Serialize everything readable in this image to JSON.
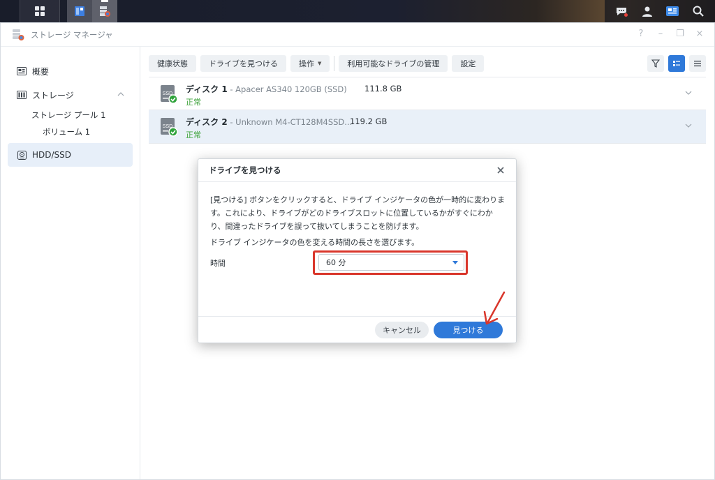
{
  "window": {
    "title": "ストレージ マネージャ",
    "controls": [
      "?",
      "–",
      "❐",
      "×"
    ]
  },
  "sidebar": {
    "items": [
      {
        "label": "概要",
        "icon": "overview-icon"
      },
      {
        "label": "ストレージ",
        "icon": "storage-icon"
      },
      {
        "label": "ストレージ プール 1"
      },
      {
        "label": "ボリューム 1"
      },
      {
        "label": "HDD/SSD",
        "icon": "hdd-icon"
      }
    ]
  },
  "toolbar": {
    "health": "健康状態",
    "find_drive": "ドライブを見つける",
    "action": "操作",
    "manage_drives": "利用可能なドライブの管理",
    "settings": "設定"
  },
  "disks": [
    {
      "name": "ディスク 1",
      "model": " - Apacer AS340 120GB (SSD)",
      "size": "111.8 GB",
      "status": "正常",
      "icon_label": "SSD"
    },
    {
      "name": "ディスク 2",
      "model": " - Unknown M4-CT128M4SSD...",
      "size": "119.2 GB",
      "status": "正常",
      "icon_label": "SSD"
    }
  ],
  "dialog": {
    "title": "ドライブを見つける",
    "description": "[見つける] ボタンをクリックすると、ドライブ インジケータの色が一時的に変わります。これにより、ドライブがどのドライブスロットに位置しているかがすぐにわかり、間違ったドライブを誤って抜いてしまうことを防げます。",
    "prompt": "ドライブ インジケータの色を変える時間の長さを選びます。",
    "time_label": "時間",
    "time_value": "60 分",
    "cancel": "キャンセル",
    "find": "見つける"
  },
  "colors": {
    "accent": "#2f79d9",
    "status_ok": "#3ea33b",
    "annotation_red": "#d9362b"
  }
}
